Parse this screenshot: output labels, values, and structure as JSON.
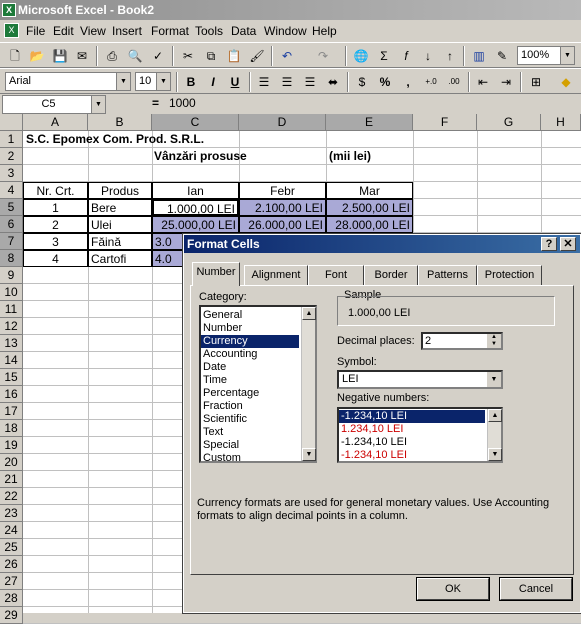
{
  "window": {
    "title": "Microsoft Excel - Book2",
    "app_icon": "X"
  },
  "menu": [
    "File",
    "Edit",
    "View",
    "Insert",
    "Format",
    "Tools",
    "Data",
    "Window",
    "Help"
  ],
  "toolbar1": {
    "zoom": "100%"
  },
  "toolbar2": {
    "font": "Arial",
    "size": "10",
    "bold": "B",
    "italic": "I",
    "underline": "U"
  },
  "formula": {
    "namebox": "C5",
    "equals": "=",
    "value": "1000"
  },
  "columns": [
    "A",
    "B",
    "C",
    "D",
    "E",
    "F",
    "G",
    "H"
  ],
  "rows": [
    "1",
    "2",
    "3",
    "4",
    "5",
    "6",
    "7",
    "8",
    "9",
    "10",
    "11",
    "12",
    "13",
    "14",
    "15",
    "16",
    "17",
    "18",
    "19",
    "20",
    "21",
    "22",
    "23",
    "24",
    "25",
    "26",
    "27",
    "28",
    "29"
  ],
  "cells": {
    "a1": "S.C. Epomex Com. Prod. S.R.L.",
    "c2": "Vânzări prosuse",
    "e2": "(mii lei)",
    "a4": "Nr. Crt.",
    "b4": "Produs",
    "c4": "Ian",
    "d4": "Febr",
    "e4": "Mar",
    "a5": "1",
    "b5": "Bere",
    "c5": "1.000,00 LEI",
    "d5": "2.100,00 LEI",
    "e5": "2.500,00 LEI",
    "a6": "2",
    "b6": "Ulei",
    "c6": "25.000,00 LEI",
    "d6": "26.000,00 LEI",
    "e6": "28.000,00 LEI",
    "a7": "3",
    "b7": "Făină",
    "c7": "3.0",
    "a8": "4",
    "b8": "Cartofi",
    "c8": "4.0"
  },
  "dialog": {
    "title": "Format Cells",
    "help": "?",
    "close": "✕",
    "tabs": [
      "Number",
      "Alignment",
      "Font",
      "Border",
      "Patterns",
      "Protection"
    ],
    "category_label": "Category:",
    "categories": [
      "General",
      "Number",
      "Currency",
      "Accounting",
      "Date",
      "Time",
      "Percentage",
      "Fraction",
      "Scientific",
      "Text",
      "Special",
      "Custom"
    ],
    "selected_category": "Currency",
    "sample_label": "Sample",
    "sample_value": "1.000,00 LEI",
    "decimal_label": "Decimal places:",
    "decimal_value": "2",
    "symbol_label": "Symbol:",
    "symbol_value": "LEI",
    "negative_label": "Negative numbers:",
    "negatives": [
      {
        "text": "-1.234,10 LEI",
        "color": "#000000"
      },
      {
        "text": "1.234,10 LEI",
        "color": "#cc0000"
      },
      {
        "text": "-1.234,10 LEI",
        "color": "#000000"
      },
      {
        "text": "-1.234,10 LEI",
        "color": "#cc0000"
      }
    ],
    "description": "Currency formats are used for general monetary values.  Use Accounting formats to align decimal points in a column.",
    "ok": "OK",
    "cancel": "Cancel"
  }
}
